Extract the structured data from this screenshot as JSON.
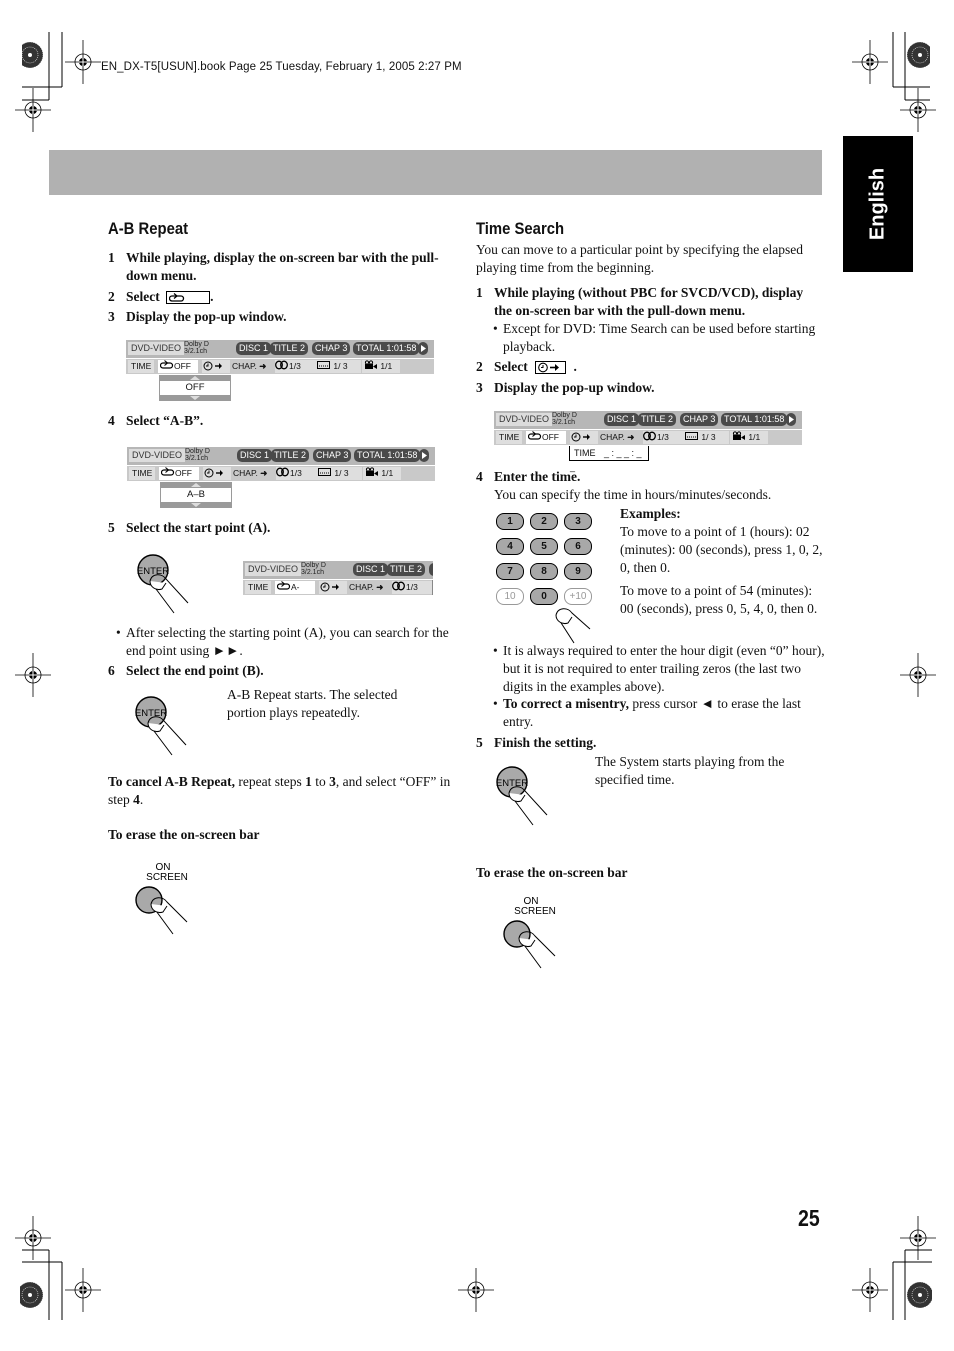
{
  "header": {
    "file_info": "EN_DX-T5[USUN].book  Page 25  Tuesday, February 1, 2005  2:27 PM"
  },
  "side_tab": {
    "label": "English"
  },
  "page_number": "25",
  "osd": {
    "format": "DVD-VIDEO",
    "audio_line1": "Dolby D",
    "audio_line2": "3/2.1ch",
    "disc": "DISC 1",
    "title": "TITLE  2",
    "chap": "CHAP  3",
    "total": "TOTAL   1:01:58",
    "play_icon": "play-icon",
    "time_label": "TIME",
    "repeat_off": "OFF",
    "repeat_a": "A-",
    "chap_label": "CHAP.",
    "audio_track": "1/3",
    "subtitle": "1/ 3",
    "angle": "1/1"
  },
  "ab_repeat": {
    "heading": "A-B Repeat",
    "step1": {
      "num": "1",
      "text": "While playing, display the on-screen bar with the pull-down menu."
    },
    "step2": {
      "num": "2",
      "text": "Select",
      "after": "."
    },
    "step3": {
      "num": "3",
      "text": "Display the pop-up window."
    },
    "popup1_value": "OFF",
    "step4": {
      "num": "4",
      "text": "Select “A-B”."
    },
    "popup2_value": "A–B",
    "step5": {
      "num": "5",
      "text": "Select the start point (A)."
    },
    "enter_label": "ENTER",
    "bullet_start": "After selecting the starting point (A), you can search for the end point using ►►.",
    "step6": {
      "num": "6",
      "text": "Select the end point (B)."
    },
    "step6_result": "A-B Repeat starts. The selected portion plays repeatedly.",
    "cancel_bold": "To cancel A-B Repeat,",
    "cancel_text1": " repeat steps ",
    "cancel_step_a": "1",
    "cancel_text2": " to ",
    "cancel_step_b": "3",
    "cancel_text3": ", and select “OFF” in step ",
    "cancel_step_c": "4",
    "cancel_text4": ".",
    "erase_heading": "To erase the on-screen bar",
    "onscreen_label1": "ON",
    "onscreen_label2": "SCREEN"
  },
  "time_search": {
    "heading": "Time Search",
    "intro": "You can move to a particular point by specifying the elapsed playing time from the beginning.",
    "step1": {
      "num": "1",
      "text": "While playing (without PBC for SVCD/VCD), display the on-screen bar with the pull-down menu."
    },
    "step1_bullet": "Except for DVD: Time Search can be used before starting playback.",
    "step2": {
      "num": "2",
      "text": "Select",
      "after": "."
    },
    "step3": {
      "num": "3",
      "text": "Display the pop-up window."
    },
    "popup_label": "TIME",
    "popup_value": "_ : _ _ : _ _",
    "step4": {
      "num": "4",
      "text": "Enter the time."
    },
    "step4_sub": "You can specify the time in hours/minutes/seconds.",
    "keypad": [
      "1",
      "2",
      "3",
      "4",
      "5",
      "6",
      "7",
      "8",
      "9",
      "10",
      "0",
      "+10"
    ],
    "examples_heading": "Examples:",
    "example1": "To move to a point of 1 (hours): 02 (minutes): 00 (seconds), press 1, 0, 2, 0, then 0.",
    "example2": "To move to a point of 54 (minutes): 00 (seconds), press 0, 5, 4, 0, then 0.",
    "bullet_hour": "It is always required to enter the hour digit (even “0” hour), but it is not required to enter trailing zeros (the last two digits in the examples above).",
    "misentry_bold": "To correct a misentry,",
    "misentry_text": " press cursor ◄ to erase the last entry.",
    "step5": {
      "num": "5",
      "text": "Finish the setting."
    },
    "step5_result": "The System starts playing from the specified time.",
    "enter_label": "ENTER",
    "erase_heading": "To erase the on-screen bar",
    "onscreen_label1": "ON",
    "onscreen_label2": "SCREEN"
  }
}
